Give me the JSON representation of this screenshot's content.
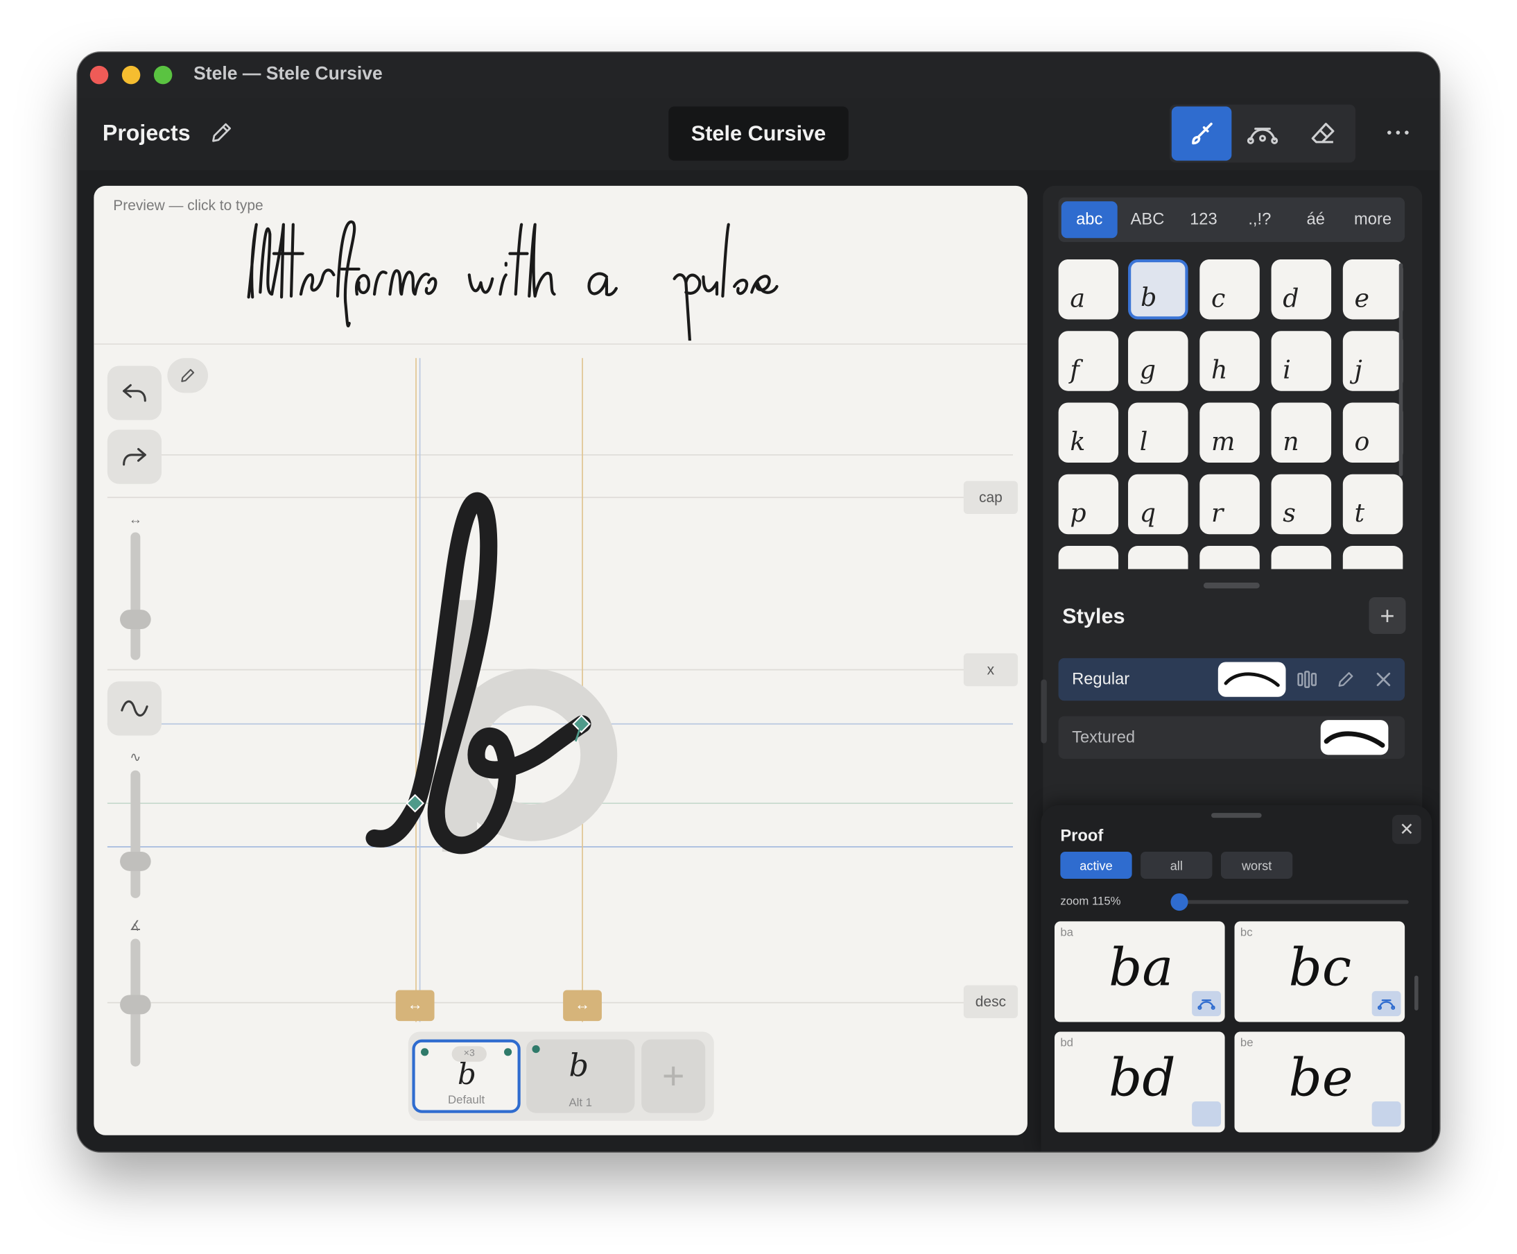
{
  "window": {
    "title": "Stele — Stele Cursive"
  },
  "toolbar": {
    "projects_label": "Projects",
    "document_name": "Stele Cursive",
    "tools": [
      {
        "name": "brush",
        "icon": "brush-icon",
        "active": true
      },
      {
        "name": "bezier",
        "icon": "bezier-icon",
        "active": false
      },
      {
        "name": "eraser",
        "icon": "eraser-icon",
        "active": false
      }
    ],
    "more_label": "···"
  },
  "canvas": {
    "preview_label": "Preview — click to type",
    "preview_text": "letterforms with a pulse",
    "guides": {
      "cap": "cap",
      "x": "x",
      "desc": "desc"
    },
    "variants": [
      {
        "label": "Default",
        "badge": "×3",
        "glyph": "b",
        "selected": true
      },
      {
        "label": "Alt 1",
        "glyph": "b",
        "selected": false
      }
    ],
    "sliders": [
      {
        "icon": "width-icon",
        "level": 0.22
      },
      {
        "icon": "tilde-icon",
        "level": 0.27
      },
      {
        "icon": "angle-icon",
        "level": 0.5
      }
    ]
  },
  "glyph_panel": {
    "tabs": [
      "abc",
      "ABC",
      "123",
      ".,!?",
      "áé",
      "more"
    ],
    "active_tab": "abc",
    "glyphs": [
      "a",
      "b",
      "c",
      "d",
      "e",
      "f",
      "g",
      "h",
      "i",
      "j",
      "k",
      "l",
      "m",
      "n",
      "o",
      "p",
      "q",
      "r",
      "s",
      "t"
    ],
    "selected_glyph": "b"
  },
  "styles": {
    "title": "Styles",
    "add_label": "+",
    "items": [
      {
        "name": "Regular",
        "active": true
      },
      {
        "name": "Textured",
        "active": false
      }
    ]
  },
  "proof": {
    "title": "Proof",
    "close_label": "✕",
    "filters": [
      "active",
      "all",
      "worst"
    ],
    "active_filter": "active",
    "zoom_label": "zoom 115%",
    "zoom_level": 0.0,
    "cards": [
      {
        "label": "ba",
        "text": "ba"
      },
      {
        "label": "bc",
        "text": "bc"
      },
      {
        "label": "bd",
        "text": "bd"
      },
      {
        "label": "be",
        "text": "be"
      }
    ]
  },
  "colors": {
    "accent": "#2f6ccf",
    "handle": "#d6b47a",
    "node": "#4f9a8a",
    "window_bg": "#1e1f21",
    "canvas_bg": "#f4f3f0"
  }
}
